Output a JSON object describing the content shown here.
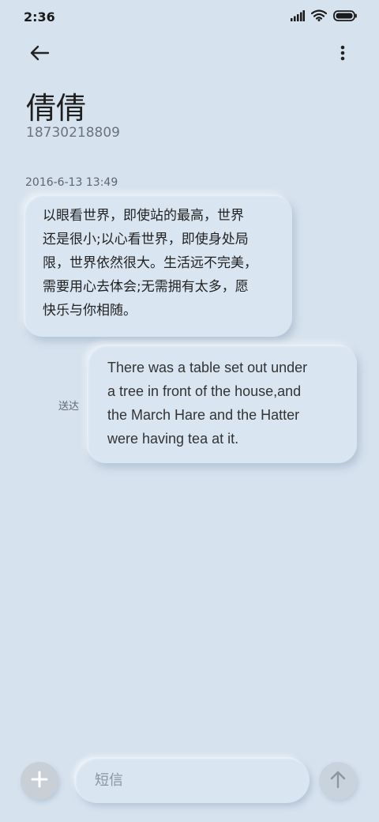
{
  "status_bar": {
    "time": "2:36",
    "icons": [
      "signal-icon",
      "wifi-icon",
      "battery-icon"
    ]
  },
  "header": {
    "back_icon": "arrow-left-icon",
    "more_icon": "more-vertical-icon"
  },
  "contact": {
    "name": "倩倩",
    "number": "18730218809"
  },
  "conversation": {
    "timestamp": "2016-6-13 13:49",
    "incoming_message": "以眼看世界，即使站的最高，世界\n还是很小;以心看世界，即使身处局\n限，世界依然很大。生活远不完美，\n需要用心去体会;无需拥有太多，愿\n快乐与你相随。",
    "outgoing_message": "There was a table set out under\na tree in front of the house,and\nthe March Hare and the Hatter\nwere having tea at it.",
    "outgoing_status": "送达"
  },
  "composer": {
    "placeholder": "短信",
    "attach_icon": "plus-icon",
    "send_icon": "arrow-up-icon"
  },
  "colors": {
    "background": "#d6e2ee",
    "bubble": "#d9e5f1",
    "attach_button": "#c9cfd6",
    "send_button": "#c9d3de"
  }
}
